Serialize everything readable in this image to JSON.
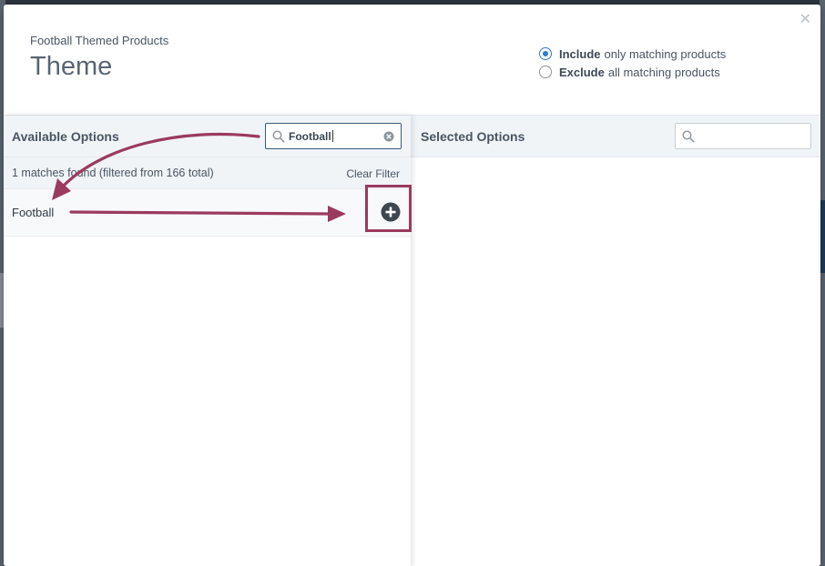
{
  "modal": {
    "subtitle": "Football Themed Products",
    "title": "Theme",
    "close_icon": "close-icon"
  },
  "filter_mode": {
    "options": [
      {
        "bold": "Include",
        "rest": "only matching products",
        "checked": true
      },
      {
        "bold": "Exclude",
        "rest": "all matching products",
        "checked": false
      }
    ]
  },
  "available": {
    "header": "Available Options",
    "search_value": "Football",
    "matches_text": "1 matches found (filtered from 166 total)",
    "clear_filter_label": "Clear Filter",
    "items": [
      {
        "label": "Football",
        "action_icon": "plus-circle-icon"
      }
    ]
  },
  "selected": {
    "header": "Selected Options",
    "search_value": ""
  },
  "colors": {
    "accent": "#2f7ad6",
    "annotation": "#9b3a5e",
    "header_bg": "#f1f4f7"
  }
}
